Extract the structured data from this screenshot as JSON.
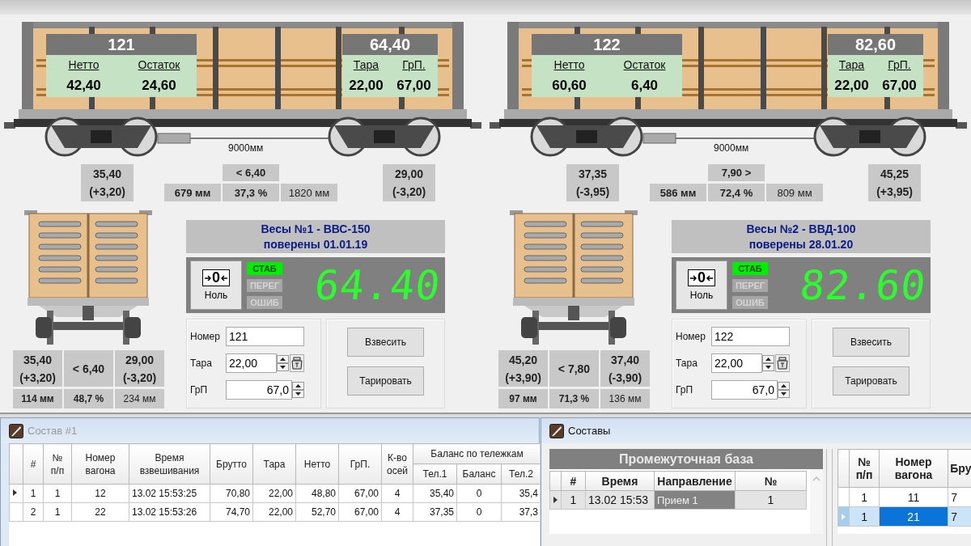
{
  "scales": [
    {
      "wagon": {
        "number": "121",
        "gross": "64,40",
        "netto_label": "Нетто",
        "netto": "42,40",
        "rest_label": "Остаток",
        "rest": "24,60",
        "tare_label": "Тара",
        "tare": "22,00",
        "grp_label": "ГрП.",
        "grp": "67,00"
      },
      "length": "9000мм",
      "bogie_left": {
        "value": "35,40",
        "delta": "(+3,20)"
      },
      "balance": {
        "diff": "< 6,40",
        "left_gap": "679 мм",
        "percent": "37,3 %",
        "right_gap": "1820 мм"
      },
      "bogie_right": {
        "value": "29,00",
        "delta": "(-3,20)"
      },
      "end_view": {
        "left_value": "35,40",
        "left_delta": "(+3,20)",
        "diff": "< 6,40",
        "right_value": "29,00",
        "right_delta": "(-3,20)",
        "left_gap": "114 мм",
        "percent": "48,7 %",
        "right_gap": "234 мм"
      },
      "title": "Весы №1 - ВВС-150",
      "verified": "поверены 01.01.19",
      "zero_symbol": "0",
      "zero_label": "Ноль",
      "status": [
        {
          "label": "СТАБ",
          "on": true
        },
        {
          "label": "ПЕРЕГ",
          "on": false
        },
        {
          "label": "ОШИБ",
          "on": false
        }
      ],
      "display": "64.40",
      "fields": [
        {
          "kind": "text",
          "label": "Номер",
          "value": "121"
        },
        {
          "kind": "tare",
          "label": "Тара",
          "value": "22,00"
        },
        {
          "kind": "number",
          "label": "ГрП",
          "value": "67,0"
        }
      ],
      "buttons": [
        "Взвесить",
        "Тарировать"
      ]
    },
    {
      "wagon": {
        "number": "122",
        "gross": "82,60",
        "netto_label": "Нетто",
        "netto": "60,60",
        "rest_label": "Остаток",
        "rest": "6,40",
        "tare_label": "Тара",
        "tare": "22,00",
        "grp_label": "ГрП.",
        "grp": "67,00"
      },
      "length": "9000мм",
      "bogie_left": {
        "value": "37,35",
        "delta": "(-3,95)"
      },
      "balance": {
        "diff": "7,90 >",
        "left_gap": "586 мм",
        "percent": "72,4 %",
        "right_gap": "809 мм"
      },
      "bogie_right": {
        "value": "45,25",
        "delta": "(+3,95)"
      },
      "end_view": {
        "left_value": "45,20",
        "left_delta": "(+3,90)",
        "diff": "< 7,80",
        "right_value": "37,40",
        "right_delta": "(-3,90)",
        "left_gap": "97 мм",
        "percent": "71,3 %",
        "right_gap": "136 мм"
      },
      "title": "Весы №2 - ВВД-100",
      "verified": "поверены 28.01.20",
      "zero_symbol": "0",
      "zero_label": "Ноль",
      "status": [
        {
          "label": "СТАБ",
          "on": true
        },
        {
          "label": "ПЕРЕГ",
          "on": false
        },
        {
          "label": "ОШИБ",
          "on": false
        }
      ],
      "display": "82.60",
      "fields": [
        {
          "kind": "text",
          "label": "Номер",
          "value": "122"
        },
        {
          "kind": "tare",
          "label": "Тара",
          "value": "22,00"
        },
        {
          "kind": "number",
          "label": "ГрП",
          "value": "67,0"
        }
      ],
      "buttons": [
        "Взвесить",
        "Тарировать"
      ]
    }
  ],
  "train_window": {
    "title": "Состав #1",
    "active": false,
    "columns": [
      "#",
      "№\nп/п",
      "Номер\nвагона",
      "Время\nвзвешивания",
      "Брутто",
      "Тара",
      "Нетто",
      "ГрП.",
      "К-во\nосей"
    ],
    "column_group": {
      "label": "Баланс по тележкам",
      "columns": [
        "Тел.1",
        "Баланс",
        "Тел.2"
      ]
    },
    "rows": [
      {
        "current": true,
        "cells": [
          "1",
          "1",
          "12",
          "13.02 15:53:25",
          "70,80",
          "22,00",
          "48,80",
          "67,00",
          "4",
          "35,40",
          "0",
          "35,4"
        ]
      },
      {
        "current": false,
        "cells": [
          "2",
          "1",
          "22",
          "13.02 15:53:26",
          "74,70",
          "22,00",
          "52,70",
          "67,00",
          "4",
          "37,35",
          "0",
          "37,3"
        ]
      }
    ]
  },
  "trains_window": {
    "title": "Составы",
    "active": true,
    "buffer": {
      "title": "Промежуточная база",
      "columns": [
        "#",
        "Время",
        "Направление",
        "№"
      ],
      "rows": [
        {
          "current": true,
          "cells": [
            {
              "text": "1",
              "focused": false
            },
            {
              "text": "13.02  15:53",
              "focused": false
            },
            {
              "text": "Прием 1",
              "focused": true
            },
            {
              "text": "1",
              "focused": false
            }
          ]
        }
      ]
    },
    "wagons": {
      "columns": [
        "№\nп/п",
        "Номер\nвагона",
        "Бру"
      ],
      "rows": [
        {
          "selected": false,
          "cells": [
            {
              "text": "1",
              "focused": false
            },
            {
              "text": "11",
              "focused": false
            },
            {
              "text": "7",
              "focused": false
            }
          ]
        },
        {
          "selected": true,
          "cells": [
            {
              "text": "1",
              "focused": false
            },
            {
              "text": "21",
              "focused": true
            },
            {
              "text": "7",
              "focused": false
            }
          ]
        }
      ]
    }
  }
}
